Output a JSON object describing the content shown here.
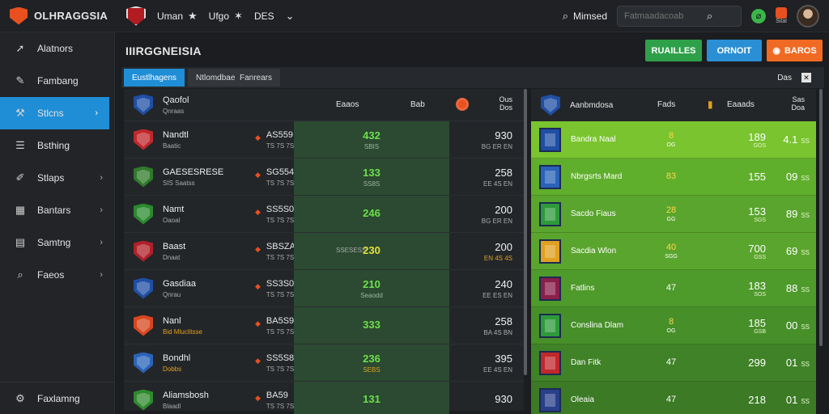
{
  "brand": {
    "name": "OLHRAGGSIA"
  },
  "topnav": {
    "items": [
      {
        "label": "Uman",
        "icon": "star-icon"
      },
      {
        "label": "Ufgo",
        "icon": "star-icon"
      },
      {
        "label": "DES",
        "icon": "chevron-down-icon"
      }
    ],
    "search_label": "Mimsed",
    "search_placeholder": "Fatmaadacoab",
    "notif_label": "Sital"
  },
  "sidebar": {
    "items": [
      {
        "label": "Alatnors",
        "chevron": false
      },
      {
        "label": "Fambang",
        "chevron": false
      },
      {
        "label": "Stlcns",
        "chevron": true,
        "active": true
      },
      {
        "label": "Bsthing",
        "chevron": false
      },
      {
        "label": "Stlaps",
        "chevron": true
      },
      {
        "label": "Bantars",
        "chevron": true
      },
      {
        "label": "Samtng",
        "chevron": true
      },
      {
        "label": "Faeos",
        "chevron": true
      }
    ],
    "bottom_label": "Faxlamng"
  },
  "page": {
    "title": "IIIRGGNEISIA",
    "buttons": {
      "green": "RUAILLES",
      "blue": "ORNOIT",
      "orange": "BAROS"
    }
  },
  "panel": {
    "tabs": [
      "Eustlhagens",
      "Ntlomdbae",
      "Fanrears"
    ],
    "right_label": "Das"
  },
  "left_table": {
    "header": {
      "title": "Qaofol",
      "subtitle": "Qnraas",
      "col1": "Eaaos",
      "col2": "Bab",
      "col3a": "Ous",
      "col3b": "Dos"
    },
    "rows": [
      {
        "name": "Nandtl",
        "sub": "Baatic",
        "v1": "AS559",
        "v2": "TS 7S 7S",
        "g1": "432",
        "g2": "SBIS",
        "r1": "930",
        "r2": "BG ER EN",
        "crest": "#c0282b"
      },
      {
        "name": "GAESESRESE",
        "sub": "SIS Saatss",
        "v1": "SG554",
        "v2": "TS 7S 7S",
        "g1": "133",
        "g2": "SS8S",
        "r1": "258",
        "r2": "EE 4S EN",
        "crest": "#2f7a2a"
      },
      {
        "name": "Namt",
        "sub": "Oaoal",
        "v1": "SS5S0",
        "v2": "TS 7S 7S",
        "g1": "246",
        "g2": "",
        "r1": "200",
        "r2": "BG ER EN",
        "crest": "#2a8a2e"
      },
      {
        "name": "Baast",
        "sub": "Dnaat",
        "v1": "SBSZA",
        "v2": "TS 7S 7S",
        "g1": "230",
        "g2": "",
        "r1": "200",
        "r2": "EN 4S 4S",
        "crest": "#b0202a",
        "yellow": true,
        "note": "SSESESS"
      },
      {
        "name": "Gasdiaa",
        "sub": "Qnrau",
        "v1": "SS3S0",
        "v2": "TS 7S 7S",
        "g1": "210",
        "g2": "Seaodd",
        "r1": "240",
        "r2": "EE ES EN",
        "crest": "#1f4fa5"
      },
      {
        "name": "Nanl",
        "sub": "Bid Mluclitsse",
        "v1": "BA5S9",
        "v2": "TS 7S 7S",
        "g1": "333",
        "g2": "",
        "r1": "258",
        "r2": "BA 4S BN",
        "crest": "#d8461f",
        "gold": true
      },
      {
        "name": "Bondhl",
        "sub": "Dobbs",
        "v1": "SS5S8",
        "v2": "TS 7S 7S",
        "g1": "236",
        "g2": "SEBS",
        "r1": "395",
        "r2": "EE 4S EN",
        "crest": "#2a63b8",
        "gold": true
      },
      {
        "name": "Aliamsbosh",
        "sub": "Blaadl",
        "v1": "BA59",
        "v2": "TS 7S 7S",
        "g1": "131",
        "g2": "",
        "r1": "930",
        "r2": "",
        "crest": "#2f8a2e"
      }
    ]
  },
  "right_table": {
    "header": {
      "title": "Aanbmdosa",
      "col1": "Fads",
      "col2": "Eaaads",
      "col3": "Sas",
      "col3b": "Doa"
    },
    "rows": [
      {
        "name": "Bandra Naal",
        "m1": "8",
        "m2": "OG",
        "v1": "189",
        "v2": "GOS",
        "w1": "4.1",
        "w2": "SS",
        "bg": "#79c42f",
        "crest": "#1f4fa5",
        "light": true
      },
      {
        "name": "Nbrgsrts Mard",
        "m1": "83",
        "m2": "",
        "v1": "155",
        "v2": "",
        "w1": "09",
        "w2": "SS",
        "bg": "#5fae2c",
        "crest": "#2a63b8"
      },
      {
        "name": "Sacdo Fiaus",
        "m1": "28",
        "m2": "GG",
        "v1": "153",
        "v2": "SGS",
        "w1": "89",
        "w2": "SS",
        "bg": "#5aa52d",
        "crest": "#2e9a3a"
      },
      {
        "name": "Sacdia Wlon",
        "m1": "40",
        "m2": "SGG",
        "v1": "700",
        "v2": "GSS",
        "w1": "69",
        "w2": "SS",
        "bg": "#5aa52d",
        "crest": "#e0a020"
      },
      {
        "name": "Fatlins",
        "m1": "47",
        "m2": "",
        "v1": "183",
        "v2": "SOS",
        "w1": "88",
        "w2": "SS",
        "bg": "#4e9a2b",
        "crest": "#8a1f4a",
        "plainm": true
      },
      {
        "name": "Conslina Dlam",
        "m1": "8",
        "m2": "OG",
        "v1": "185",
        "v2": "GSB",
        "w1": "00",
        "w2": "SS",
        "bg": "#478f29",
        "crest": "#2e9a3a"
      },
      {
        "name": "Dan Fitk",
        "m1": "47",
        "m2": "",
        "v1": "299",
        "v2": "",
        "w1": "01",
        "w2": "SS",
        "bg": "#3f8227",
        "crest": "#c0282b",
        "plainm": true
      },
      {
        "name": "Oleaia",
        "m1": "47",
        "m2": "",
        "v1": "218",
        "v2": "",
        "w1": "01",
        "w2": "SS",
        "bg": "#3c7a26",
        "crest": "#2a3f8a",
        "plainm": true
      }
    ]
  }
}
